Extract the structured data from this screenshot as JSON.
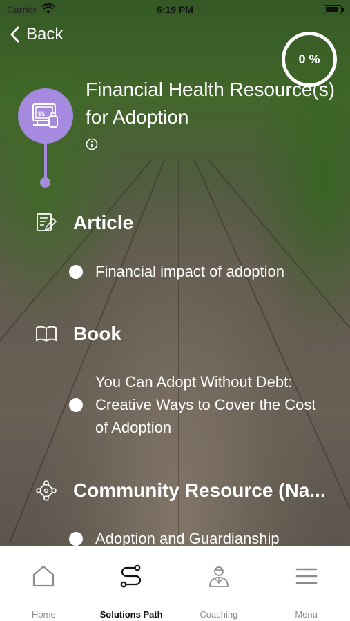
{
  "status_bar": {
    "carrier": "Carrier",
    "time": "6:19 PM"
  },
  "nav": {
    "back_label": "Back"
  },
  "progress": {
    "label": "0 %",
    "value": 0
  },
  "header": {
    "title": "Financial Health Resource(s) for Adoption",
    "badge_icon": "money-bottle-icon",
    "accent": "#a68ae0"
  },
  "sections": [
    {
      "label": "Article",
      "icon": "article-edit-icon",
      "items": [
        "Financial impact of adoption"
      ]
    },
    {
      "label": "Book",
      "icon": "open-book-icon",
      "items": [
        "You Can Adopt Without Debt: Creative Ways to Cover the Cost of Adoption"
      ]
    },
    {
      "label": "Community Resource (Na...",
      "icon": "community-network-icon",
      "items": [
        "Adoption and Guardianship"
      ]
    }
  ],
  "tabbar": {
    "tabs": [
      {
        "label": "Home",
        "icon": "home-icon"
      },
      {
        "label": "Solutions Path",
        "icon": "path-icon",
        "active": true
      },
      {
        "label": "Coaching",
        "icon": "coach-icon"
      },
      {
        "label": "Menu",
        "icon": "hamburger-menu-icon"
      }
    ]
  }
}
